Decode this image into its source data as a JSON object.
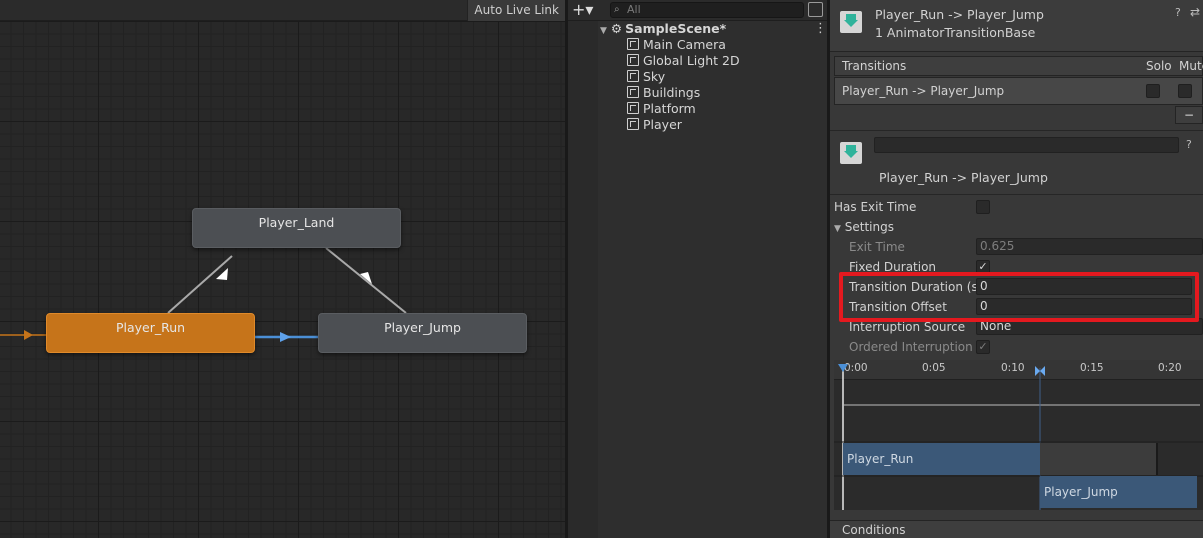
{
  "graph": {
    "auto_live_link": "Auto Live Link",
    "nodes": {
      "land": "Player_Land",
      "run": "Player_Run",
      "jump": "Player_Jump"
    }
  },
  "hierarchy": {
    "search_placeholder": "All",
    "scene": "SampleScene*",
    "items": [
      "Main Camera",
      "Global Light 2D",
      "Sky",
      "Buildings",
      "Platform",
      "Player"
    ]
  },
  "inspector": {
    "title": "Player_Run -> Player_Jump",
    "subtitle": "1 AnimatorTransitionBase",
    "transitions_header": "Transitions",
    "solo_label": "Solo",
    "mute_label": "Mute",
    "transition_row": "Player_Run -> Player_Jump",
    "minus_label": "−",
    "transition_name": "Player_Run -> Player_Jump",
    "has_exit_time_label": "Has Exit Time",
    "settings_label": "Settings",
    "exit_time_label": "Exit Time",
    "exit_time_value": "0.625",
    "fixed_duration_label": "Fixed Duration",
    "transition_duration_label": "Transition Duration (s)",
    "transition_duration_value": "0",
    "transition_offset_label": "Transition Offset",
    "transition_offset_value": "0",
    "interruption_source_label": "Interruption Source",
    "interruption_source_value": "None",
    "ordered_interruption_label": "Ordered Interruption",
    "timeline_ticks": [
      "0:00",
      "0:05",
      "0:10",
      "0:15",
      "0:20"
    ],
    "timeline_source": "Player_Run",
    "timeline_dest": "Player_Jump",
    "conditions_label": "Conditions",
    "check_mark": "✓"
  }
}
